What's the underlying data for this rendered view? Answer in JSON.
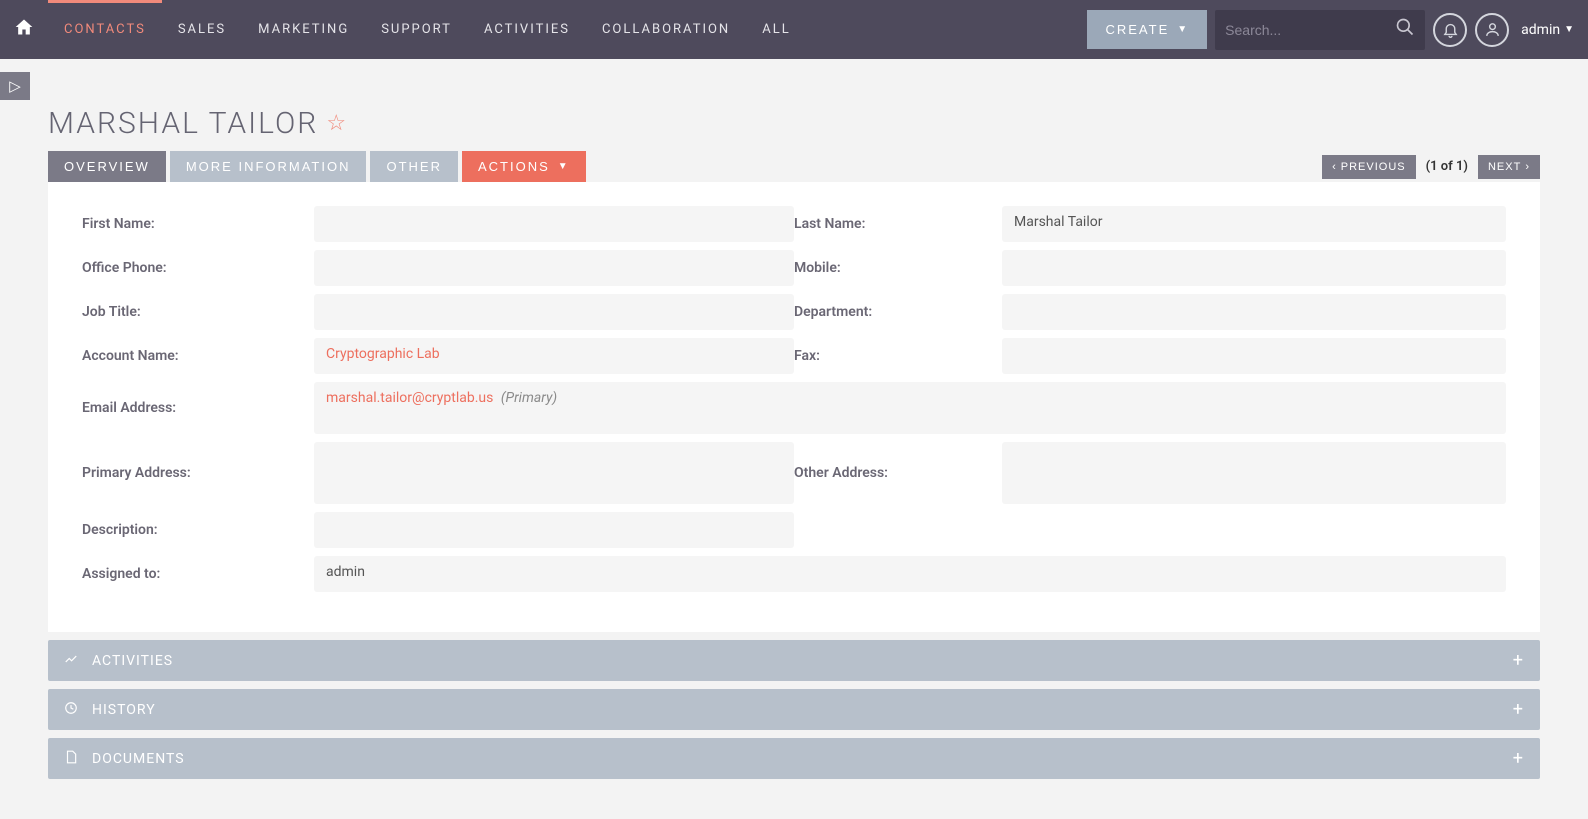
{
  "nav": {
    "tabs": [
      {
        "label": "CONTACTS",
        "active": true
      },
      {
        "label": "SALES"
      },
      {
        "label": "MARKETING"
      },
      {
        "label": "SUPPORT"
      },
      {
        "label": "ACTIVITIES"
      },
      {
        "label": "COLLABORATION"
      },
      {
        "label": "ALL"
      }
    ],
    "create_label": "CREATE",
    "search_placeholder": "Search...",
    "user_label": "admin"
  },
  "page": {
    "title": "MARSHAL TAILOR",
    "tabs": {
      "overview": "OVERVIEW",
      "more_info": "MORE INFORMATION",
      "other": "OTHER",
      "actions": "ACTIONS"
    },
    "pager": {
      "previous": "PREVIOUS",
      "next": "NEXT",
      "info": "(1 of 1)"
    }
  },
  "form": {
    "first_name": {
      "label": "First Name:",
      "value": ""
    },
    "last_name": {
      "label": "Last Name:",
      "value": "Marshal Tailor"
    },
    "office_phone": {
      "label": "Office Phone:",
      "value": ""
    },
    "mobile": {
      "label": "Mobile:",
      "value": ""
    },
    "job_title": {
      "label": "Job Title:",
      "value": ""
    },
    "department": {
      "label": "Department:",
      "value": ""
    },
    "account_name": {
      "label": "Account Name:",
      "value": "Cryptographic Lab"
    },
    "fax": {
      "label": "Fax:",
      "value": ""
    },
    "email": {
      "label": "Email Address:",
      "value": "marshal.tailor@cryptlab.us",
      "suffix": "(Primary)"
    },
    "primary_address": {
      "label": "Primary Address:",
      "value": ""
    },
    "other_address": {
      "label": "Other Address:",
      "value": ""
    },
    "description": {
      "label": "Description:",
      "value": ""
    },
    "assigned_to": {
      "label": "Assigned to:",
      "value": "admin"
    }
  },
  "sections": {
    "activities": "ACTIVITIES",
    "history": "HISTORY",
    "documents": "DOCUMENTS"
  }
}
